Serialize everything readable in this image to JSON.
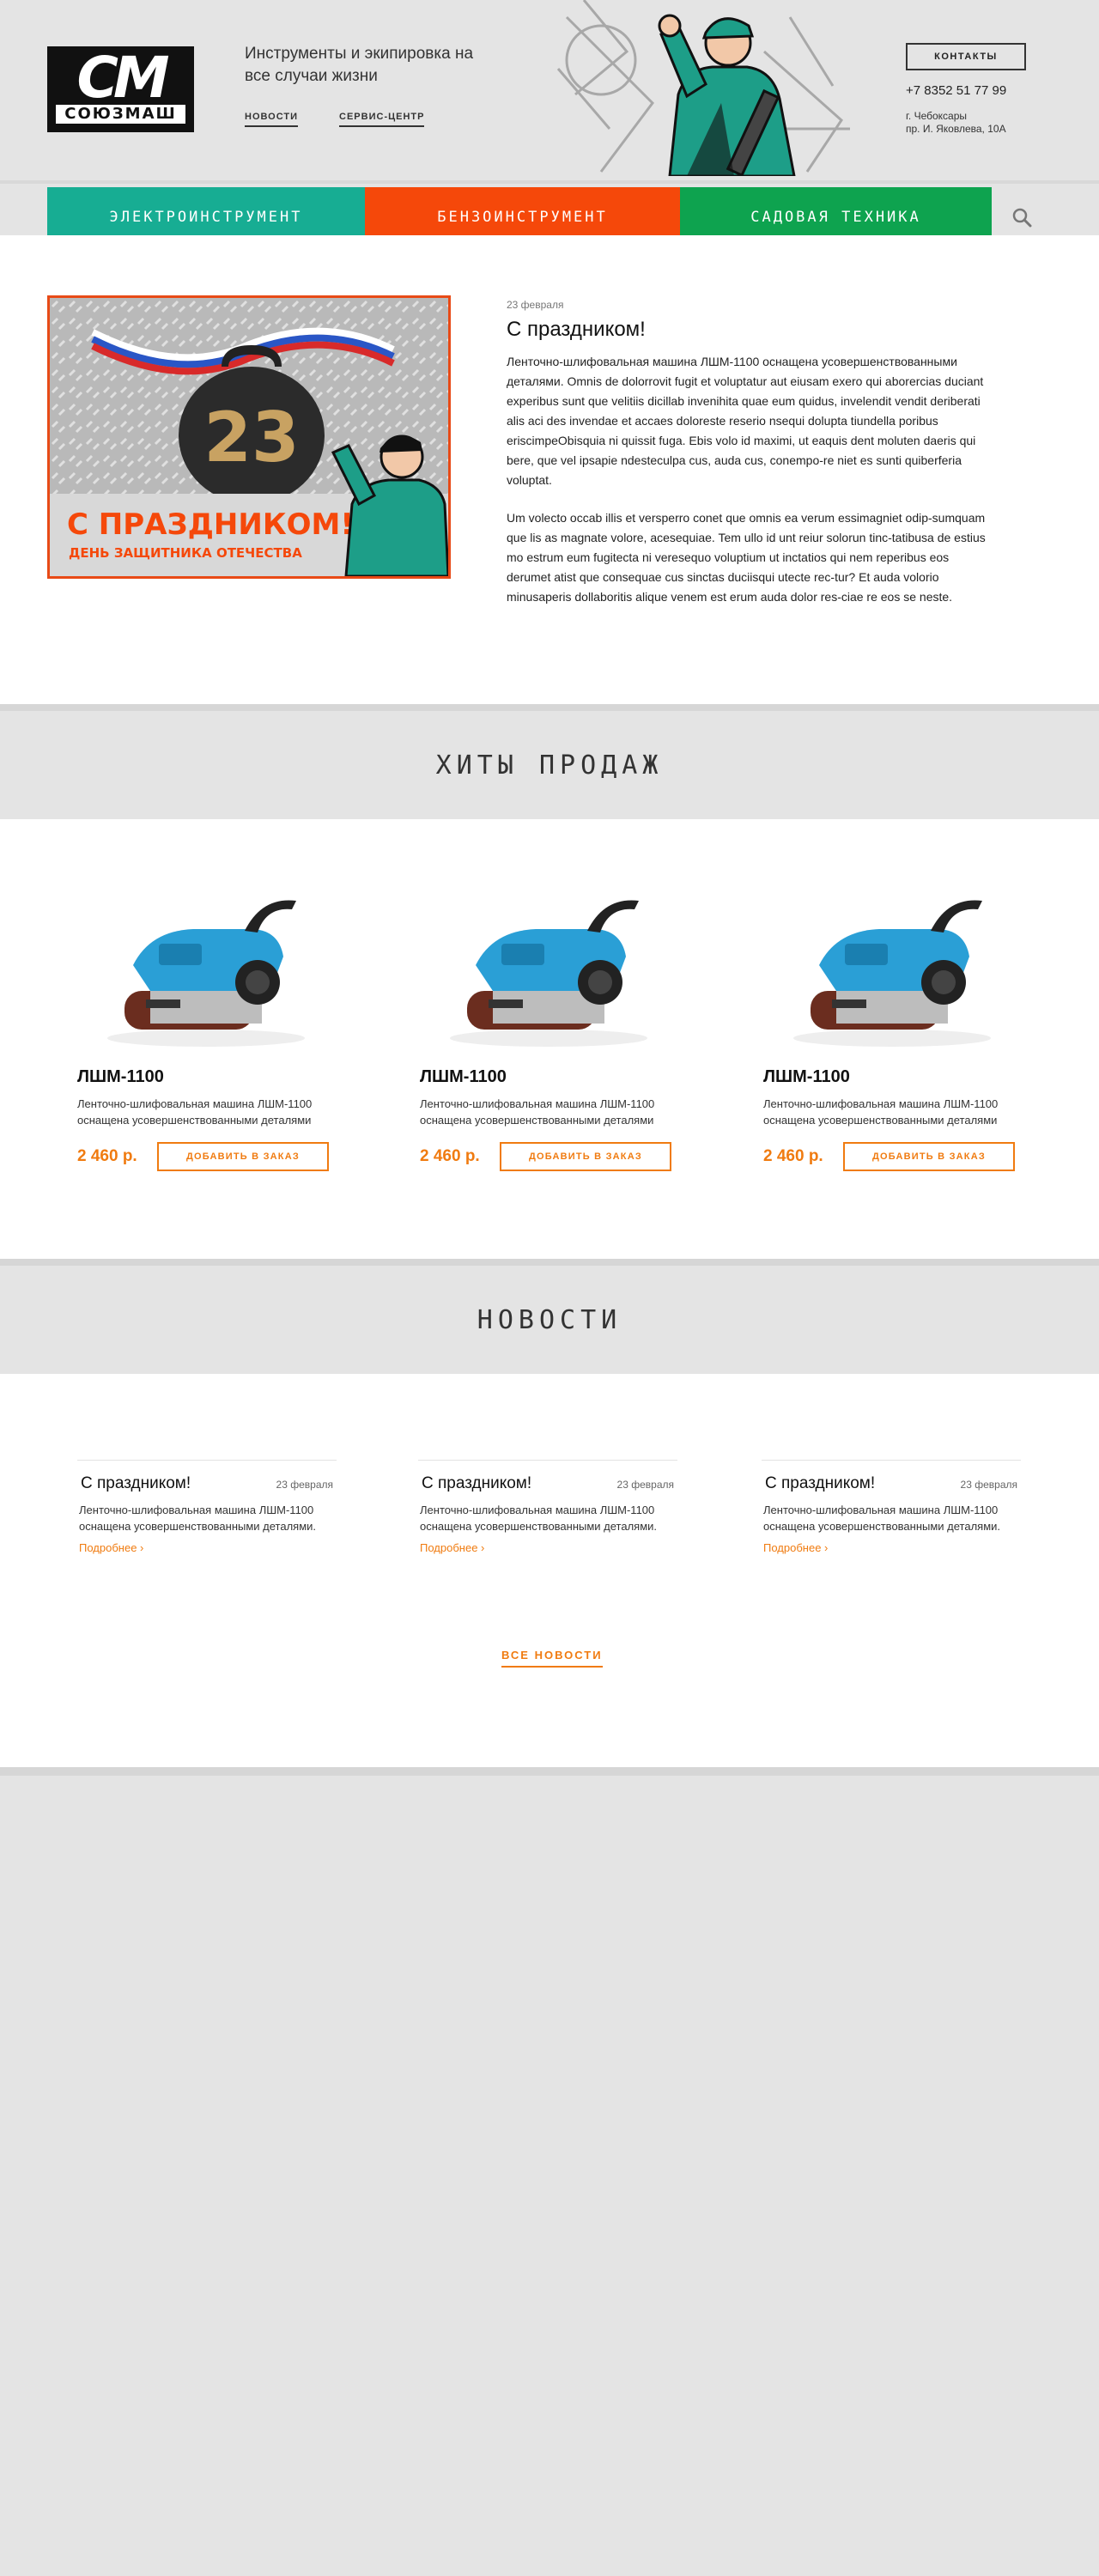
{
  "header": {
    "logo_mark": "СМ",
    "logo_word": "СОЮЗМАШ",
    "tagline": "Инструменты и экипировка на все случаи жизни",
    "nav": [
      "НОВОСТИ",
      "СЕРВИС-ЦЕНТР"
    ],
    "contacts_label": "КОНТАКТЫ",
    "phone": "+7 8352 51 77 99",
    "address_line1": "г. Чебоксары",
    "address_line2": "пр. И. Яковлева, 10А"
  },
  "categories": [
    "ЭЛЕКТРОИНСТРУМЕНТ",
    "БЕНЗОИНСТРУМЕНТ",
    "САДОВАЯ ТЕХНИКА"
  ],
  "colors": {
    "teal": "#17ad93",
    "orange_red": "#f5480a",
    "green": "#0ea34f",
    "accent": "#f07b10"
  },
  "icons": {
    "search": "search-icon"
  },
  "featured": {
    "date": "23 февраля",
    "title": "С праздником!",
    "banner_number": "23",
    "banner_title": "С ПРАЗДНИКОМ!",
    "banner_subtitle": "ДЕНЬ ЗАЩИТНИКА ОТЕЧЕСТВА",
    "paragraph1": "Ленточно-шлифовальная машина ЛШМ-1100 оснащена усовершенствованными деталями. Omnis de dolorrovit fugit et voluptatur aut eiusam exero qui aborercias duciant experibus sunt que velitiis dicillab invenihita quae eum quidus, invelendit vendit deriberati alis aci des invendae et accaes doloreste reserio nsequi dolupta tiundella poribus eriscimpeObisquia ni quissit fuga. Ebis volo id maximi, ut eaquis dent moluten daeris qui bere, que vel ipsapie ndesteculpa cus, auda cus, conempo-re niet es sunti quiberferia voluptat.",
    "paragraph2": "Um volecto occab illis et versperro conet que omnis ea verum essimagniet odip-sumquam que lis as magnate volore, acesequiae. Tem ullo id unt reiur solorun tinc-tatibusa de estius mo estrum eum fugitecta ni veresequo voluptium ut inctatios qui nem reperibus eos derumet atist que consequae cus sinctas duciisqui utecte rec-tur? Et auda volorio minusaperis dollaboritis alique venem est erum auda dolor res-ciae re eos se neste."
  },
  "hits": {
    "title": "ХИТЫ ПРОДАЖ",
    "products": [
      {
        "name": "ЛШМ-1100",
        "desc": "Ленточно-шлифовальная машина ЛШМ-1100 оснащена усовершенствованными деталями",
        "price": "2 460 р.",
        "button": "ДОБАВИТЬ В ЗАКАЗ"
      },
      {
        "name": "ЛШМ-1100",
        "desc": "Ленточно-шлифовальная машина ЛШМ-1100 оснащена усовершенствованными деталями",
        "price": "2 460 р.",
        "button": "ДОБАВИТЬ В ЗАКАЗ"
      },
      {
        "name": "ЛШМ-1100",
        "desc": "Ленточно-шлифовальная машина ЛШМ-1100 оснащена усовершенствованными деталями",
        "price": "2 460 р.",
        "button": "ДОБАВИТЬ В ЗАКАЗ"
      }
    ]
  },
  "news": {
    "title": "НОВОСТИ",
    "items": [
      {
        "title": "С праздником!",
        "date": "23 февраля",
        "desc": "Ленточно-шлифовальная машина ЛШМ-1100 оснащена усовершенствованными деталями.",
        "more": "Подробнее ›"
      },
      {
        "title": "С праздником!",
        "date": "23 февраля",
        "desc": "Ленточно-шлифовальная машина ЛШМ-1100 оснащена усовершенствованными деталями.",
        "more": "Подробнее ›"
      },
      {
        "title": "С праздником!",
        "date": "23 февраля",
        "desc": "Ленточно-шлифовальная машина ЛШМ-1100 оснащена усовершенствованными деталями.",
        "more": "Подробнее ›"
      }
    ],
    "all_label": "ВСЕ НОВОСТИ"
  }
}
